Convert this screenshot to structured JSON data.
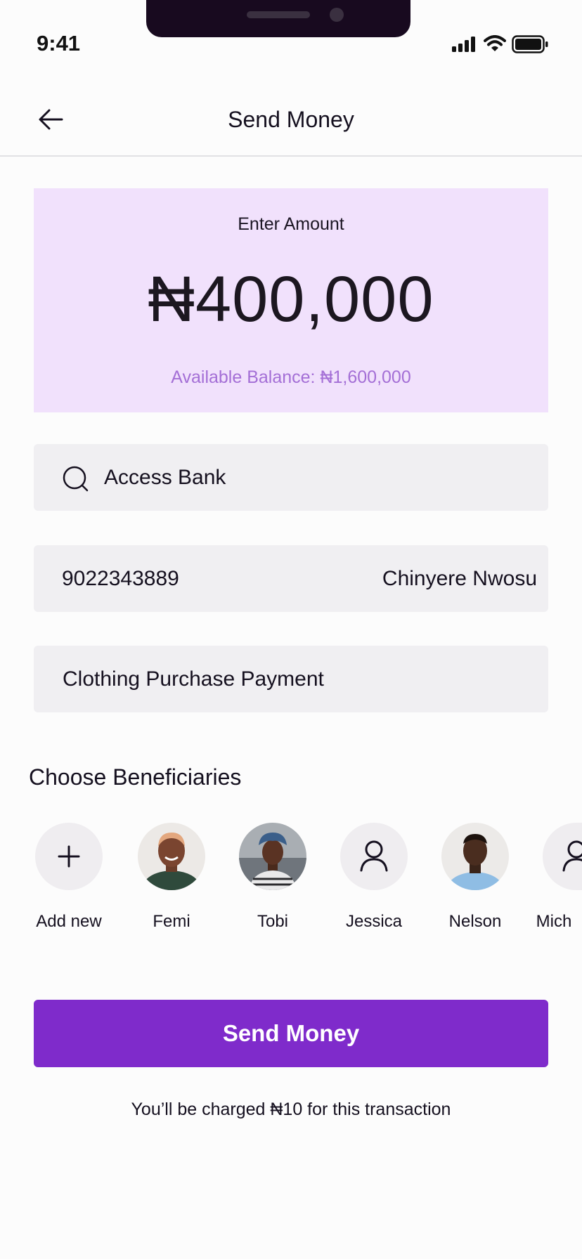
{
  "status_bar": {
    "time": "9:41"
  },
  "header": {
    "title": "Send Money",
    "back_icon": "arrow-left-icon"
  },
  "amount_card": {
    "label": "Enter Amount",
    "amount": "₦400,000",
    "balance": "Available Balance: ₦1,600,000"
  },
  "bank_field": {
    "icon": "search-icon",
    "value": "Access Bank"
  },
  "account_field": {
    "number": "9022343889",
    "name": "Chinyere Nwosu"
  },
  "narration_field": {
    "value": "Clothing Purchase Payment"
  },
  "beneficiaries": {
    "title": "Choose Beneficiaries",
    "items": [
      {
        "label": "Add new",
        "icon": "plus-icon"
      },
      {
        "label": "Femi",
        "icon": "avatar-photo"
      },
      {
        "label": "Tobi",
        "icon": "avatar-photo"
      },
      {
        "label": "Jessica",
        "icon": "user-icon"
      },
      {
        "label": "Nelson",
        "icon": "avatar-photo"
      },
      {
        "label": "Mich",
        "icon": "user-icon"
      }
    ]
  },
  "cta": {
    "label": "Send Money",
    "note": "You’ll be charged ₦10 for this transaction"
  },
  "colors": {
    "accent": "#7f2bcb",
    "amount_card_bg": "#f1e1fc",
    "balance_text": "#a46fd6",
    "field_bg": "#f0eff2"
  }
}
